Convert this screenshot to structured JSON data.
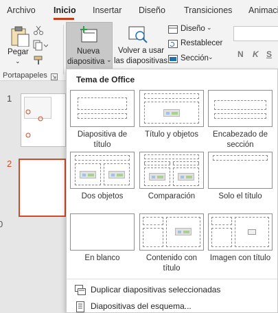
{
  "tabs": [
    {
      "label": "Archivo",
      "active": false
    },
    {
      "label": "Inicio",
      "active": true
    },
    {
      "label": "Insertar",
      "active": false
    },
    {
      "label": "Diseño",
      "active": false
    },
    {
      "label": "Transiciones",
      "active": false
    },
    {
      "label": "Animaci",
      "active": false
    }
  ],
  "ribbon": {
    "paste_label": "Pegar",
    "new_slide_line1": "Nueva",
    "new_slide_line2": "diapositiva",
    "reuse_line1": "Volver a usar",
    "reuse_line2": "las diapositivas",
    "layout_label": "Diseño",
    "reset_label": "Restablecer",
    "section_label": "Sección",
    "clipboard_group": "Portapapeles",
    "format_buttons": [
      "N",
      "K",
      "S"
    ]
  },
  "slides": {
    "numbers": [
      "1",
      "2"
    ],
    "left_edge_glyph": "0"
  },
  "gallery": {
    "title": "Tema de Office",
    "layouts": [
      {
        "name": "Diapositiva de título",
        "line1": "Diapositiva de",
        "line2": "título"
      },
      {
        "name": "Título y objetos",
        "line1": "Título y objetos",
        "line2": ""
      },
      {
        "name": "Encabezado de sección",
        "line1": "Encabezado de",
        "line2": "sección"
      },
      {
        "name": "Dos objetos",
        "line1": "Dos objetos",
        "line2": ""
      },
      {
        "name": "Comparación",
        "line1": "Comparación",
        "line2": ""
      },
      {
        "name": "Solo el título",
        "line1": "Solo el título",
        "line2": ""
      },
      {
        "name": "En blanco",
        "line1": "En blanco",
        "line2": ""
      },
      {
        "name": "Contenido con título",
        "line1": "Contenido con",
        "line2": "título"
      },
      {
        "name": "Imagen con título",
        "line1": "Imagen con título",
        "line2": ""
      }
    ],
    "menu": [
      {
        "label": "Duplicar diapositivas seleccionadas",
        "icon": "duplicate-slides-icon"
      },
      {
        "label": "Diapositivas del esquema...",
        "icon": "outline-icon"
      }
    ]
  },
  "colors": {
    "accent": "#c43e1c",
    "selected_slide_border": "#d04a27",
    "button_pressed": "#c8c8c8"
  }
}
